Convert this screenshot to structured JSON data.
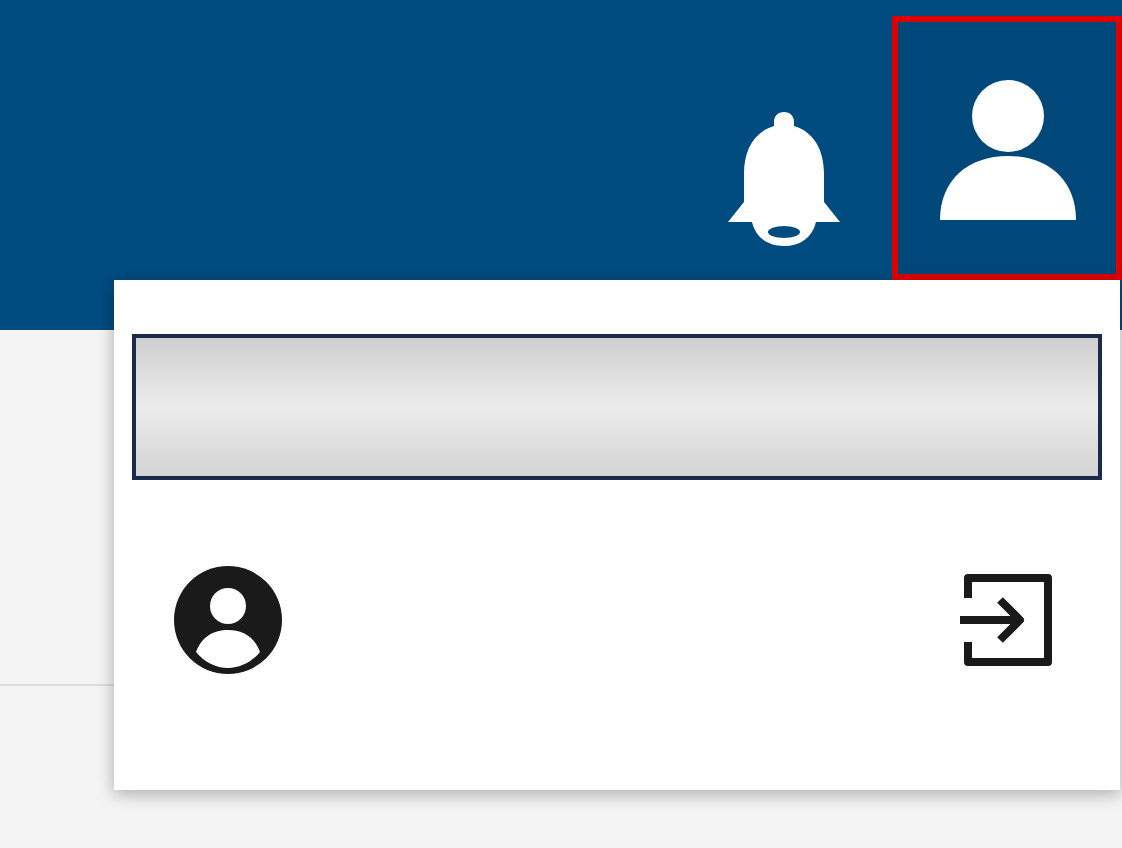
{
  "header": {
    "user_button": {
      "selected": true
    }
  },
  "dropdown": {
    "expanded": true
  }
}
